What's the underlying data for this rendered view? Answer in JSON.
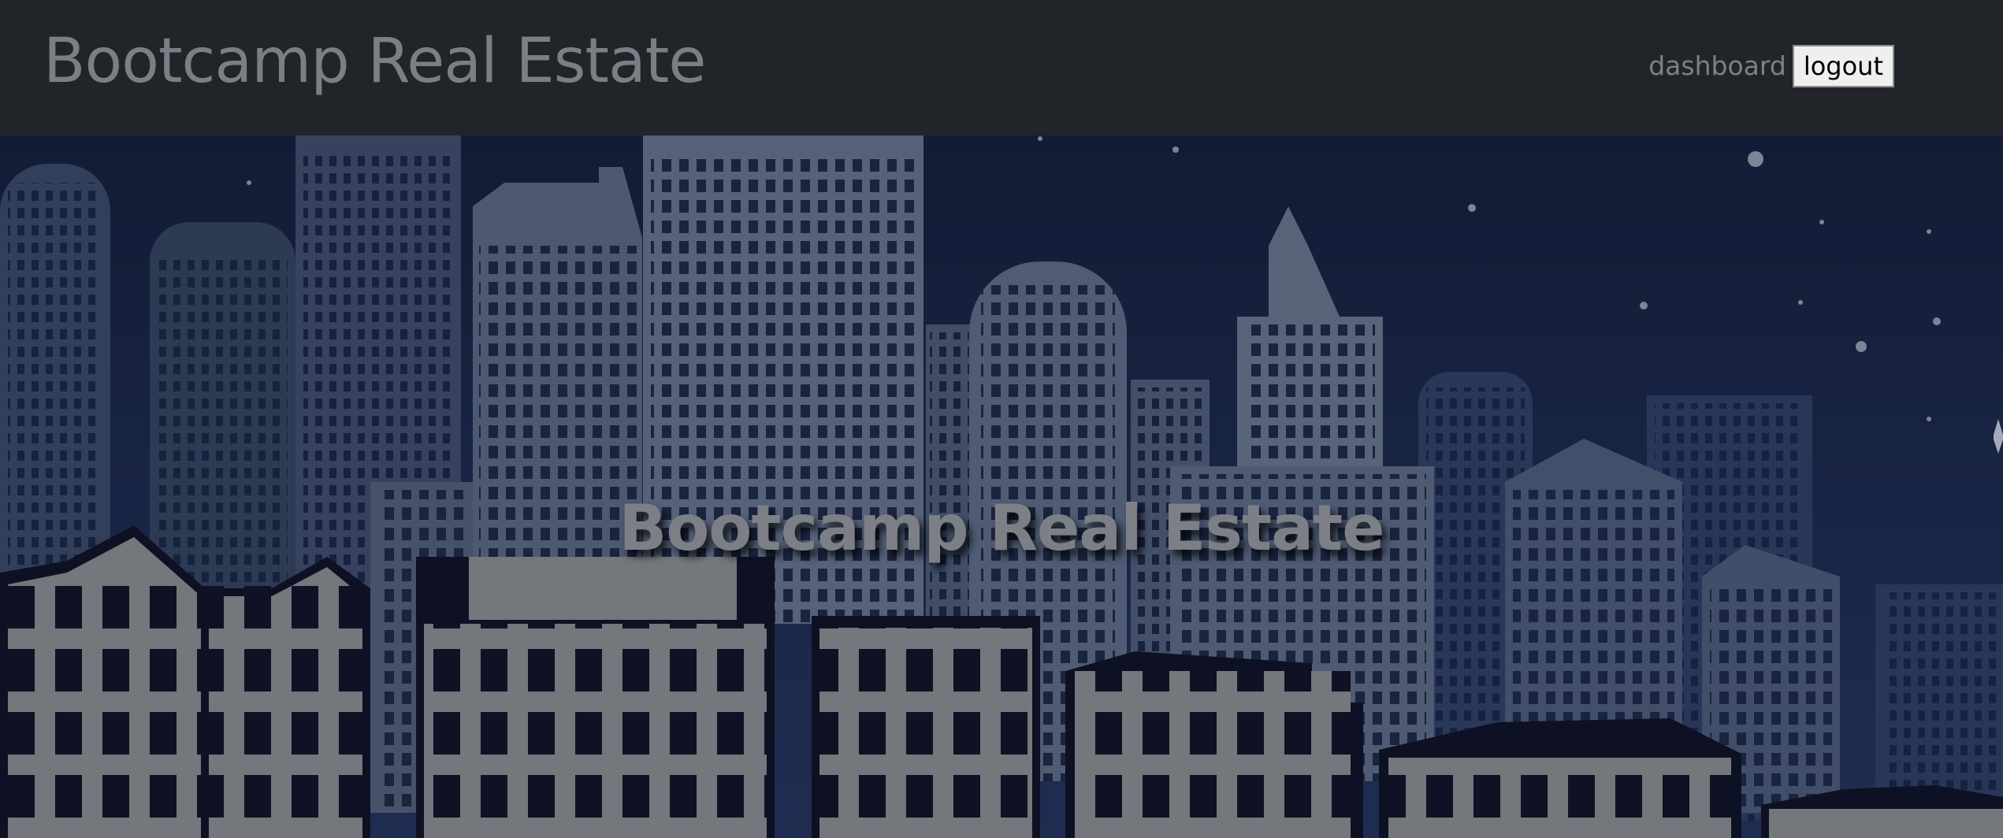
{
  "navbar": {
    "brand": "Bootcamp Real Estate",
    "links": {
      "dashboard_label": "dashboard"
    },
    "logout_label": "logout"
  },
  "hero": {
    "title": "Bootcamp Real Estate",
    "image_subject": "city-skyline-night-illustration",
    "colors": {
      "sky": "#1c2a4d",
      "towers": "#57657c",
      "buildings_light": "#86898e",
      "buildings_dark": "#0f1428",
      "overlay": "#000000"
    }
  }
}
